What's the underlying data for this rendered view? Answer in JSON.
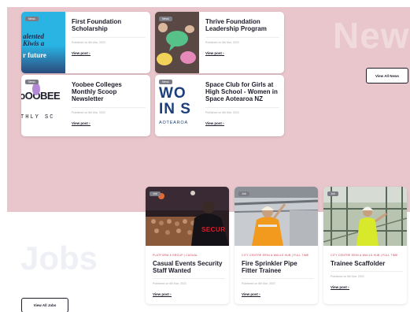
{
  "news": {
    "section_title": "News",
    "view_all_label": "View All News",
    "cards": [
      {
        "badge": "News",
        "title": "First Foundation Scholarship",
        "date": "Published on 6th Mar, 2023",
        "link": "View post ›",
        "thumb_text": [
          "alented",
          "Kiwis a",
          "r future"
        ]
      },
      {
        "badge": "News",
        "title": "Thrive Foundation Leadership Program",
        "date": "Published on 6th Mar, 2023",
        "link": "View post ›"
      },
      {
        "badge": "News",
        "title": "Yoobee Colleges Monthly Scoop Newsletter",
        "date": "Published on 6th Mar, 2023",
        "link": "View post ›",
        "thumb_text": [
          "ɔOOBEE",
          "THLY SC"
        ]
      },
      {
        "badge": "News",
        "title": "Space Club for Girls at High School - Women in Space Aotearoa NZ",
        "date": "Published on 6th Mar, 2023",
        "link": "View post ›",
        "thumb_text": [
          "WO",
          "IN S",
          "AOTEAROA"
        ]
      }
    ]
  },
  "jobs": {
    "section_title": "Jobs",
    "view_all_label": "View All Jobs",
    "cards": [
      {
        "badge": "Job",
        "category": "PLATFORM 8 GROUP | CASUAL",
        "title": "Casual Events Security Staff Wanted",
        "date": "Published on 6th Mar, 2023",
        "link": "View post ›",
        "photo_text": "SECUR"
      },
      {
        "badge": "Job",
        "category": "CITY CENTRE ERIN & WALLS HUB | FULL TIME",
        "title": "Fire Sprinkler Pipe Fitter Trainee",
        "date": "Published on 6th Mar, 2023",
        "link": "View post ›"
      },
      {
        "badge": "Job",
        "category": "CITY CENTRE ERIN & WALLS HUB | FULL TIME",
        "title": "Trainee Scaffolder",
        "date": "Published on 6th Mar, 2023",
        "link": "View post ›"
      }
    ]
  },
  "colors": {
    "news_background": "#e8c6cc",
    "accent_category": "#c8425d",
    "thumb_cyan": "#29b4e4",
    "thumb_navy": "#2a4a7c",
    "badge_grey": "#7c7c86"
  }
}
